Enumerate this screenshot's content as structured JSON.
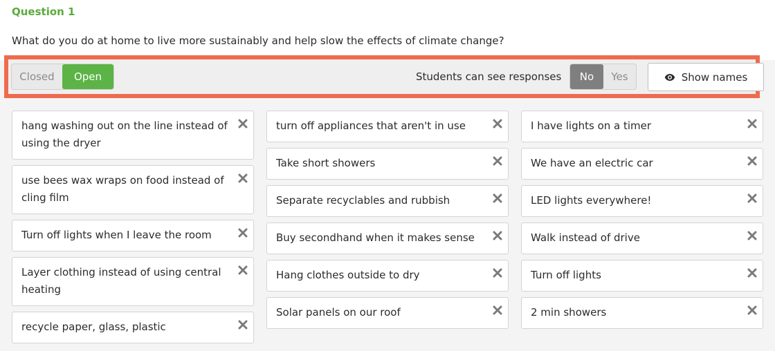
{
  "question": {
    "title": "Question 1",
    "text": "What do you do at home to live more sustainably and help slow the effects of climate change?"
  },
  "toolbar": {
    "status_closed": "Closed",
    "status_open": "Open",
    "status_selected": "Open",
    "responses_label": "Students can see responses",
    "visibility_no": "No",
    "visibility_yes": "Yes",
    "visibility_selected": "No",
    "show_names_label": "Show names"
  },
  "columns": [
    [
      "hang washing out on the line instead of using the dryer",
      "use bees wax wraps on food instead of cling film",
      "Turn off lights when I leave the room",
      "Layer clothing instead of using central heating",
      "recycle paper, glass, plastic"
    ],
    [
      "turn off appliances that aren't in use",
      "Take short showers",
      "Separate recyclables and rubbish",
      "Buy secondhand when it makes sense",
      "Hang clothes outside to dry",
      "Solar panels on our roof"
    ],
    [
      "I have lights on a timer",
      "We have an electric car",
      "LED lights everywhere!",
      "Walk instead of drive",
      "Turn off lights",
      "2 min showers"
    ]
  ],
  "colors": {
    "accent_green": "#5cb346",
    "highlight_border": "#ef6b4e",
    "selected_gray": "#7f7f7f"
  }
}
